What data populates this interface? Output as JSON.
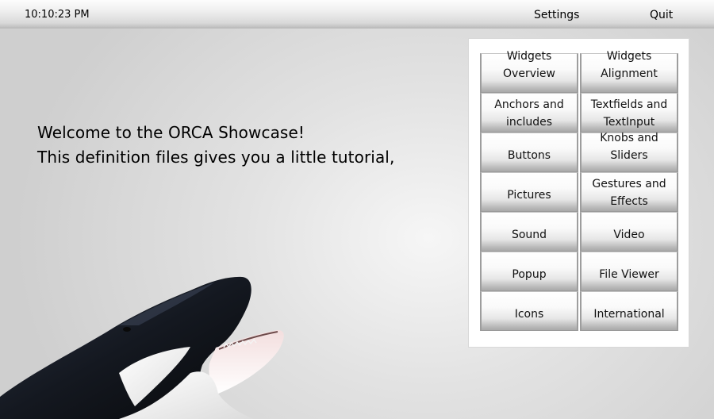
{
  "topbar": {
    "clock": "10:10:23 PM",
    "settings_label": "Settings",
    "quit_label": "Quit"
  },
  "welcome": {
    "line1": "Welcome to the ORCA Showcase!",
    "line2": "This definition files gives you a little tutorial,"
  },
  "menu": {
    "items": [
      {
        "label": "Widgets Overview"
      },
      {
        "label": "Widgets Alignment"
      },
      {
        "label": "Anchors and includes"
      },
      {
        "label": "Textfields and TextInput"
      },
      {
        "label": "Buttons"
      },
      {
        "label": "Knobs and Sliders"
      },
      {
        "label": "Pictures"
      },
      {
        "label": "Gestures and Effects"
      },
      {
        "label": "Sound"
      },
      {
        "label": "Video"
      },
      {
        "label": "Popup"
      },
      {
        "label": "File Viewer"
      },
      {
        "label": "Icons"
      },
      {
        "label": "International"
      }
    ]
  },
  "colors": {
    "background": "#e2e2e2",
    "panel": "#ffffff",
    "button_top": "#ffffff",
    "button_bottom": "#a9a9a9"
  },
  "illustration": "orca-whale-image"
}
